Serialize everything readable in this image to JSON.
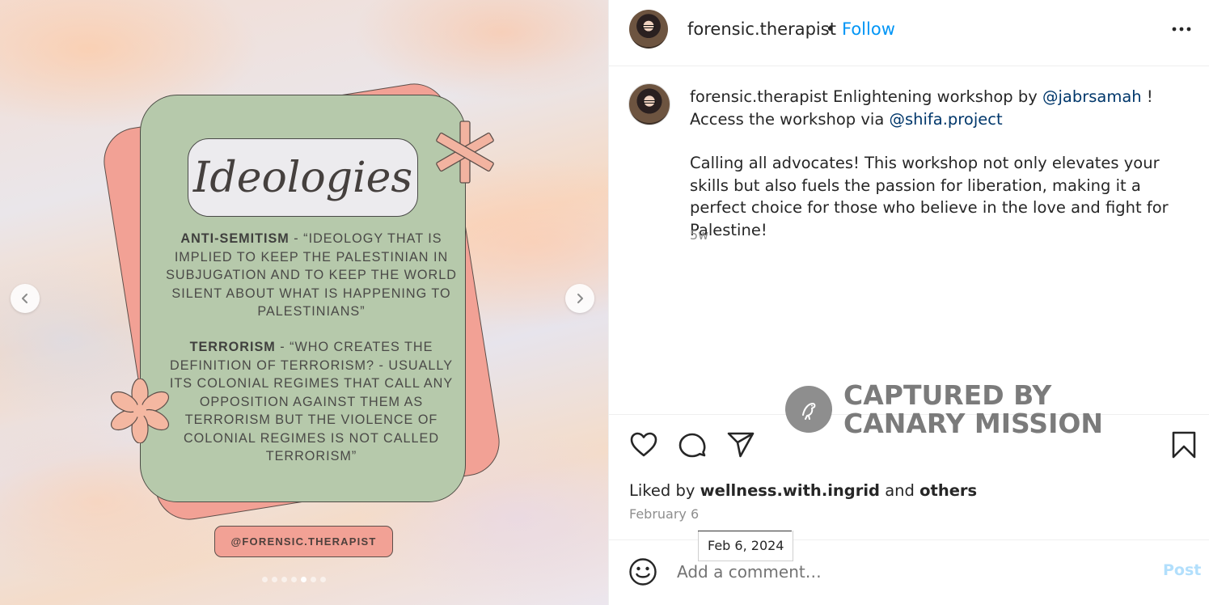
{
  "media": {
    "card_title": "Ideologies",
    "term1": "ANTI-SEMITISM",
    "term1_def": " - “IDEOLOGY THAT IS IMPLIED TO KEEP THE PALESTINIAN IN SUBJUGATION AND TO KEEP THE WORLD SILENT ABOUT WHAT IS HAPPENING TO PALESTINIANS”",
    "term2": "TERRORISM",
    "term2_def": " - “WHO CREATES THE DEFINITION OF TERRORISM? - USUALLY ITS COLONIAL REGIMES THAT CALL ANY OPPOSITION AGAINST THEM AS TERRORISM BUT THE VIOLENCE OF COLONIAL REGIMES IS NOT CALLED TERRORISM”",
    "handle": "@FORENSIC.THERAPIST",
    "slide_count": 7,
    "active_slide": 5,
    "colors": {
      "card_green": "#b6c9ab",
      "card_salmon": "#f2a195"
    }
  },
  "header": {
    "username": "forensic.therapist",
    "separator": "•",
    "follow_label": "Follow",
    "more_icon": "more-horizontal-icon"
  },
  "caption": {
    "username": "forensic.therapist",
    "text1": " Enlightening workshop by ",
    "mention1": "@jabrsamah",
    "text2": " !",
    "text3": "Access the workshop via ",
    "mention2": "@shifa.project",
    "paragraph2": "Calling all advocates! This workshop not only elevates your skills but also fuels the passion for liberation, making it a perfect choice for those who believe in the love and fight for Palestine!",
    "age": "5w"
  },
  "watermark": {
    "line1": "CAPTURED BY",
    "line2": "CANARY MISSION"
  },
  "engagement": {
    "liked_prefix": "Liked by ",
    "liked_user": "wellness.with.ingrid",
    "liked_mid": " and ",
    "liked_others": "others",
    "date": "February 6",
    "tooltip": "Feb 6, 2024"
  },
  "comment": {
    "placeholder": "Add a comment…",
    "post_label": "Post"
  },
  "colors": {
    "accent": "#0095f6",
    "mention": "#00376b",
    "muted": "#8e8e8e"
  }
}
